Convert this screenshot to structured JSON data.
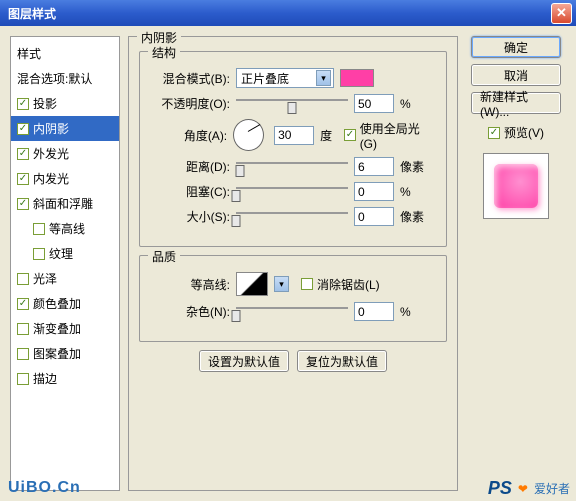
{
  "title": "图层样式",
  "left": {
    "header": "样式",
    "blend": "混合选项:默认",
    "items": [
      {
        "label": "投影",
        "checked": true,
        "selected": false
      },
      {
        "label": "内阴影",
        "checked": true,
        "selected": true
      },
      {
        "label": "外发光",
        "checked": true,
        "selected": false
      },
      {
        "label": "内发光",
        "checked": true,
        "selected": false
      },
      {
        "label": "斜面和浮雕",
        "checked": true,
        "selected": false
      },
      {
        "label": "等高线",
        "checked": false,
        "selected": false,
        "indent": true
      },
      {
        "label": "纹理",
        "checked": false,
        "selected": false,
        "indent": true
      },
      {
        "label": "光泽",
        "checked": false,
        "selected": false
      },
      {
        "label": "颜色叠加",
        "checked": true,
        "selected": false
      },
      {
        "label": "渐变叠加",
        "checked": false,
        "selected": false
      },
      {
        "label": "图案叠加",
        "checked": false,
        "selected": false
      },
      {
        "label": "描边",
        "checked": false,
        "selected": false
      }
    ]
  },
  "center": {
    "panel_title": "内阴影",
    "structure": {
      "legend": "结构",
      "blend_mode_label": "混合模式(B):",
      "blend_mode_value": "正片叠底",
      "opacity_label": "不透明度(O):",
      "opacity_value": "50",
      "opacity_unit": "%",
      "angle_label": "角度(A):",
      "angle_value": "30",
      "angle_unit": "度",
      "global_light": "使用全局光(G)",
      "distance_label": "距离(D):",
      "distance_value": "6",
      "distance_unit": "像素",
      "choke_label": "阻塞(C):",
      "choke_value": "0",
      "choke_unit": "%",
      "size_label": "大小(S):",
      "size_value": "0",
      "size_unit": "像素"
    },
    "quality": {
      "legend": "品质",
      "contour_label": "等高线:",
      "antialias": "消除锯齿(L)",
      "noise_label": "杂色(N):",
      "noise_value": "0",
      "noise_unit": "%"
    },
    "buttons": {
      "default": "设置为默认值",
      "reset": "复位为默认值"
    }
  },
  "right": {
    "ok": "确定",
    "cancel": "取消",
    "newstyle": "新建样式(W)...",
    "preview": "预览(V)"
  },
  "footer": {
    "brand": "PS",
    "text": "爱好者",
    "url": "UiBO.Cn"
  }
}
